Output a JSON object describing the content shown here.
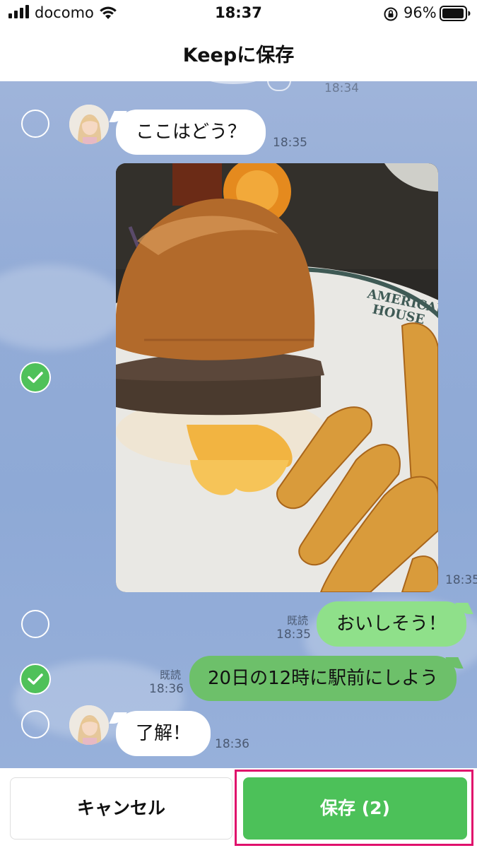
{
  "status_bar": {
    "carrier": "docomo",
    "time": "18:37",
    "battery_percent": "96%",
    "icons": [
      "signal-icon",
      "wifi-icon",
      "orientation-lock-icon",
      "battery-icon"
    ]
  },
  "header": {
    "title": "Keepに保存"
  },
  "chat": {
    "prev_time": "18:34",
    "messages": [
      {
        "type": "incoming_text",
        "text": "ここはどう？",
        "time": "18:35",
        "selected": false
      },
      {
        "type": "incoming_photo",
        "description_icon": "photo",
        "time": "18:35",
        "selected": true
      },
      {
        "type": "outgoing_text",
        "text": "おいしそう！",
        "read": "既読",
        "time": "18:35",
        "selected": false
      },
      {
        "type": "outgoing_text",
        "text": "20日の12時に駅前にしよう",
        "read": "既読",
        "time": "18:36",
        "selected": true
      },
      {
        "type": "incoming_text",
        "text": "了解！",
        "time": "18:36",
        "selected": false
      }
    ]
  },
  "footer": {
    "cancel_label": "キャンセル",
    "save_label": "保存 (2)"
  },
  "colors": {
    "accent_green": "#4cc159",
    "outgoing_light": "#8fe08a",
    "outgoing_dark": "#6dc06a",
    "highlight": "#e0116c",
    "chat_background": "#93acd7"
  }
}
